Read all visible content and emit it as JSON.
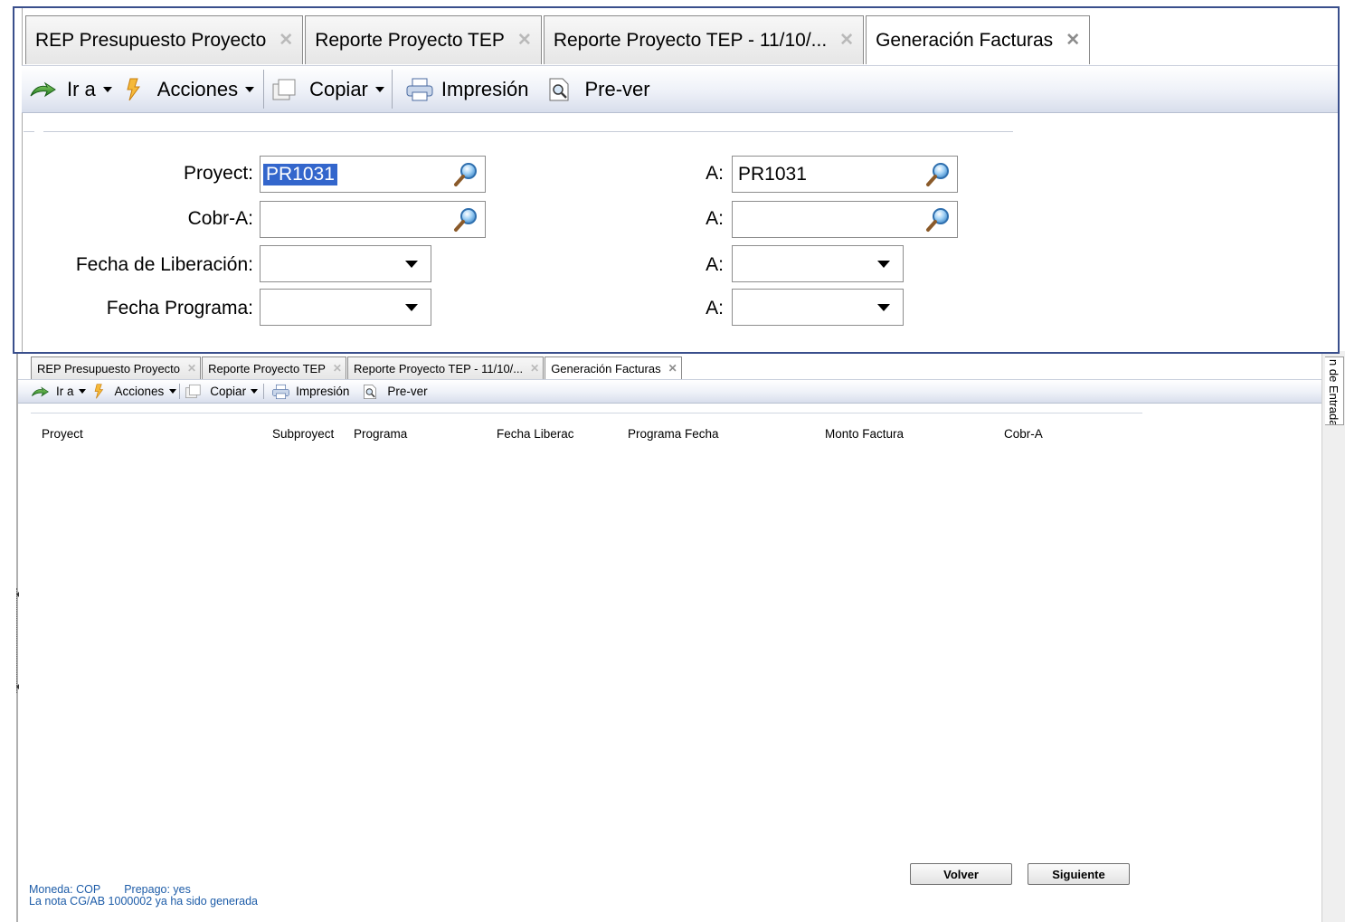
{
  "top_window": {
    "tabs": [
      {
        "label": "REP Presupuesto Proyecto",
        "active": false
      },
      {
        "label": "Reporte Proyecto TEP",
        "active": false
      },
      {
        "label": "Reporte Proyecto TEP - 11/10/...",
        "active": false
      },
      {
        "label": "Generación Facturas",
        "active": true
      }
    ],
    "toolbar": {
      "ira": "Ir a",
      "acciones": "Acciones",
      "copiar": "Copiar",
      "impresion": "Impresión",
      "prever": "Pre-ver"
    },
    "form": {
      "proyect_label": "Proyect:",
      "proyect_value": "PR1031",
      "proyect_to_label": "A:",
      "proyect_to_value": "PR1031",
      "cobra_label": "Cobr-A:",
      "cobra_value": "",
      "cobra_to_label": "A:",
      "cobra_to_value": "",
      "fecha_lib_label": "Fecha de Liberación:",
      "fecha_lib_value": "",
      "fecha_lib_to_label": "A:",
      "fecha_lib_to_value": "",
      "fecha_prog_label": "Fecha Programa:",
      "fecha_prog_value": "",
      "fecha_prog_to_label": "A:",
      "fecha_prog_to_value": ""
    }
  },
  "bottom_window": {
    "tabs": [
      {
        "label": "REP Presupuesto Proyecto",
        "active": false
      },
      {
        "label": "Reporte Proyecto TEP",
        "active": false
      },
      {
        "label": "Reporte Proyecto TEP - 11/10/...",
        "active": false
      },
      {
        "label": "Generación Facturas",
        "active": true
      }
    ],
    "toolbar": {
      "ira": "Ir a",
      "acciones": "Acciones",
      "copiar": "Copiar",
      "impresion": "Impresión",
      "prever": "Pre-ver"
    },
    "columns": [
      "Proyect",
      "Subproyect",
      "Programa",
      "Fecha Liberac",
      "Programa Fecha",
      "Monto Factura",
      "Cobr-A"
    ],
    "buttons": {
      "volver": "Volver",
      "siguiente": "Siguiente"
    },
    "status": {
      "moneda": "Moneda: COP",
      "prepago": "Prepago: yes",
      "message": "La nota CG/AB 1000002 ya ha sido generada"
    }
  },
  "right_panel": {
    "tab_label": "n de Entrada"
  },
  "colors": {
    "window_border": "#3a4f8c",
    "selection": "#3366cc",
    "status_text": "#1d5ca8"
  }
}
